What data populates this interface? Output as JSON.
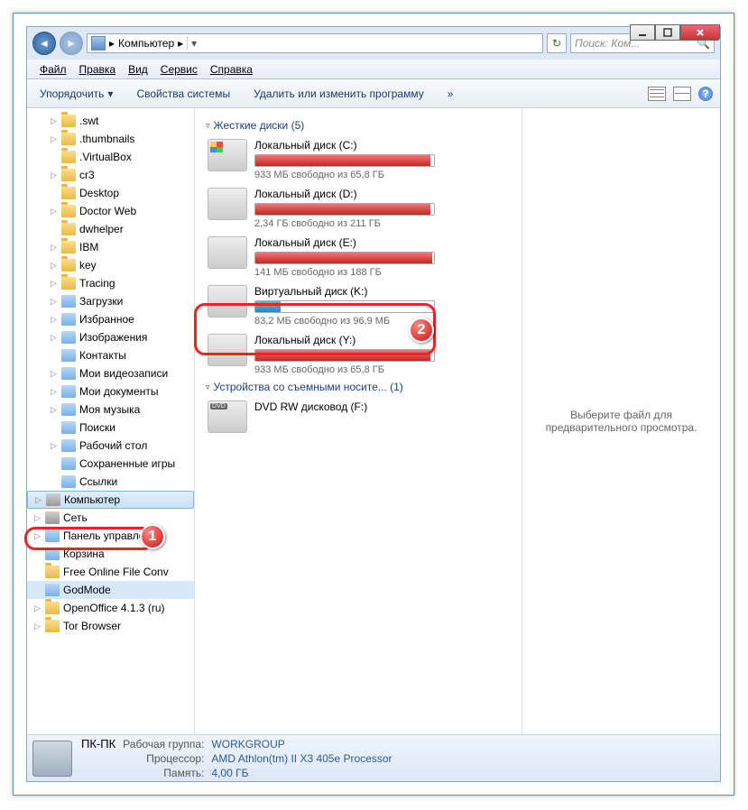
{
  "address": {
    "text": "Компьютер",
    "sep": "▸"
  },
  "search": {
    "placeholder": "Поиск: Ком..."
  },
  "menu": [
    "Файл",
    "Правка",
    "Вид",
    "Сервис",
    "Справка"
  ],
  "toolbar": {
    "organize": "Упорядочить",
    "sysprops": "Свойства системы",
    "uninstall": "Удалить или изменить программу",
    "more": "»"
  },
  "tree": [
    {
      "arrow": "▷",
      "label": ".swt",
      "indent": 1
    },
    {
      "arrow": "▷",
      "label": ".thumbnails",
      "indent": 1
    },
    {
      "arrow": "",
      "label": ".VirtualBox",
      "indent": 1
    },
    {
      "arrow": "▷",
      "label": "cr3",
      "indent": 1
    },
    {
      "arrow": "",
      "label": "Desktop",
      "indent": 1
    },
    {
      "arrow": "▷",
      "label": "Doctor Web",
      "indent": 1
    },
    {
      "arrow": "",
      "label": "dwhelper",
      "indent": 1
    },
    {
      "arrow": "▷",
      "label": "IBM",
      "indent": 1
    },
    {
      "arrow": "▷",
      "label": "key",
      "indent": 1
    },
    {
      "arrow": "▷",
      "label": "Tracing",
      "indent": 1
    },
    {
      "arrow": "▷",
      "label": "Загрузки",
      "indent": 1,
      "icon": "spec"
    },
    {
      "arrow": "▷",
      "label": "Избранное",
      "indent": 1,
      "icon": "spec"
    },
    {
      "arrow": "▷",
      "label": "Изображения",
      "indent": 1,
      "icon": "spec"
    },
    {
      "arrow": "",
      "label": "Контакты",
      "indent": 1,
      "icon": "spec"
    },
    {
      "arrow": "▷",
      "label": "Мои видеозаписи",
      "indent": 1,
      "icon": "spec"
    },
    {
      "arrow": "▷",
      "label": "Мои документы",
      "indent": 1,
      "icon": "spec"
    },
    {
      "arrow": "▷",
      "label": "Моя музыка",
      "indent": 1,
      "icon": "spec"
    },
    {
      "arrow": "",
      "label": "Поиски",
      "indent": 1,
      "icon": "spec"
    },
    {
      "arrow": "▷",
      "label": "Рабочий стол",
      "indent": 1,
      "icon": "spec"
    },
    {
      "arrow": "",
      "label": "Сохраненные игры",
      "indent": 1,
      "icon": "spec"
    },
    {
      "arrow": "",
      "label": "Ссылки",
      "indent": 1,
      "icon": "spec"
    },
    {
      "arrow": "▷",
      "label": "Компьютер",
      "indent": 0,
      "icon": "comp",
      "sel": true
    },
    {
      "arrow": "▷",
      "label": "Сеть",
      "indent": 0,
      "icon": "comp"
    },
    {
      "arrow": "▷",
      "label": "Панель управления",
      "indent": 0,
      "icon": "spec"
    },
    {
      "arrow": "",
      "label": "Корзина",
      "indent": 0,
      "icon": "spec"
    },
    {
      "arrow": "",
      "label": "Free Online File Conv",
      "indent": 0
    },
    {
      "arrow": "",
      "label": "GodMode",
      "indent": 0,
      "icon": "spec",
      "selbg": true
    },
    {
      "arrow": "▷",
      "label": "OpenOffice 4.1.3 (ru)",
      "indent": 0
    },
    {
      "arrow": "▷",
      "label": "Tor Browser",
      "indent": 0
    }
  ],
  "groups": {
    "hdd": {
      "title": "Жесткие диски (5)"
    },
    "removable": {
      "title": "Устройства со съемными носите... (1)"
    }
  },
  "drives": [
    {
      "name": "Локальный диск (C:)",
      "free": "933 МБ свободно из 65,8 ГБ",
      "pct": 98,
      "color": "red",
      "ico": "win"
    },
    {
      "name": "Локальный диск (D:)",
      "free": "2,34 ГБ свободно из 211 ГБ",
      "pct": 98,
      "color": "red"
    },
    {
      "name": "Локальный диск (E:)",
      "free": "141 МБ свободно из 188 ГБ",
      "pct": 99,
      "color": "red"
    },
    {
      "name": "Виртуальный диск (K:)",
      "free": "83,2 МБ свободно из 96,9 МБ",
      "pct": 14,
      "color": "blue"
    },
    {
      "name": "Локальный диск (Y:)",
      "free": "933 МБ свободно из 65,8 ГБ",
      "pct": 98,
      "color": "red"
    }
  ],
  "dvd": {
    "name": "DVD RW дисковод (F:)"
  },
  "preview": "Выберите файл для предварительного просмотра.",
  "status": {
    "name": "ПК-ПК",
    "workgroup_lbl": "Рабочая группа:",
    "workgroup": "WORKGROUP",
    "cpu_lbl": "Процессор:",
    "cpu": "AMD Athlon(tm) II X3 405e Processor",
    "mem_lbl": "Память:",
    "mem": "4,00 ГБ"
  },
  "callouts": {
    "c1": "1",
    "c2": "2"
  }
}
